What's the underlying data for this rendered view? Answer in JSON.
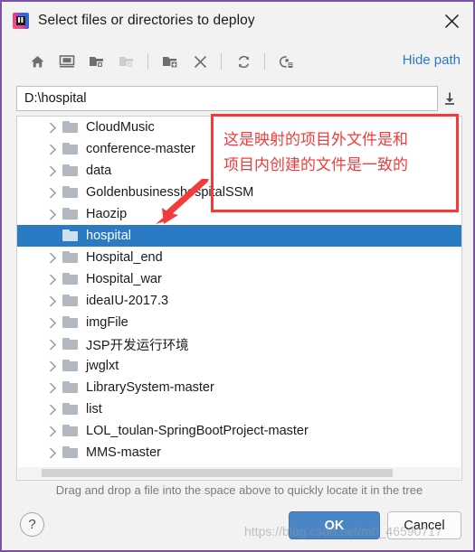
{
  "window": {
    "title": "Select files or directories to deploy",
    "app_icon": "intellij-idea-icon",
    "close_icon": "close-icon",
    "border_color": "#7a52a3"
  },
  "toolbar": {
    "buttons": [
      {
        "name": "home-icon",
        "tooltip": "Home"
      },
      {
        "name": "desktop-icon",
        "tooltip": "Desktop"
      },
      {
        "name": "project-folder-icon",
        "tooltip": "Project Directory"
      },
      {
        "name": "module-folder-icon",
        "tooltip": "Module Directory"
      },
      {
        "name": "new-folder-icon",
        "tooltip": "New Folder"
      },
      {
        "name": "delete-icon",
        "tooltip": "Delete"
      },
      {
        "name": "refresh-icon",
        "tooltip": "Refresh"
      },
      {
        "name": "show-hidden-icon",
        "tooltip": "Show Hidden Files and Directories"
      }
    ],
    "hide_path_label": "Hide path"
  },
  "path": {
    "value": "D:\\hospital",
    "placeholder": "",
    "expand_icon": "download-arrow-icon"
  },
  "tree": {
    "items": [
      {
        "label": "CloudMusic",
        "expandable": true,
        "selected": false
      },
      {
        "label": "conference-master",
        "expandable": true,
        "selected": false
      },
      {
        "label": "data",
        "expandable": true,
        "selected": false
      },
      {
        "label": "GoldenbusinesshospitalSSM",
        "expandable": true,
        "selected": false
      },
      {
        "label": "Haozip",
        "expandable": true,
        "selected": false
      },
      {
        "label": "hospital",
        "expandable": false,
        "selected": true
      },
      {
        "label": "Hospital_end",
        "expandable": true,
        "selected": false
      },
      {
        "label": "Hospital_war",
        "expandable": true,
        "selected": false
      },
      {
        "label": "ideaIU-2017.3",
        "expandable": true,
        "selected": false
      },
      {
        "label": "imgFile",
        "expandable": true,
        "selected": false
      },
      {
        "label": "JSP开发运行环境",
        "expandable": true,
        "selected": false
      },
      {
        "label": "jwglxt",
        "expandable": true,
        "selected": false
      },
      {
        "label": "LibrarySystem-master",
        "expandable": true,
        "selected": false
      },
      {
        "label": "list",
        "expandable": true,
        "selected": false
      },
      {
        "label": "LOL_toulan-SpringBootProject-master",
        "expandable": true,
        "selected": false
      },
      {
        "label": "MMS-master",
        "expandable": true,
        "selected": false
      }
    ],
    "selected_color": "#2b7ac4",
    "hscrollbar": "horizontal-scrollbar"
  },
  "hint": "Drag and drop a file into the space above to quickly locate it in the tree",
  "footer": {
    "help_label": "?",
    "ok_label": "OK",
    "cancel_label": "Cancel",
    "ok_color": "#4a86c5"
  },
  "annotation": {
    "text": "这是映射的项目外文件是和\n项目内创建的文件是一致的",
    "color": "#f43b3b",
    "arrow": "annotation-arrow"
  },
  "watermark": "https://blog.csdn.net/m0_46590717"
}
